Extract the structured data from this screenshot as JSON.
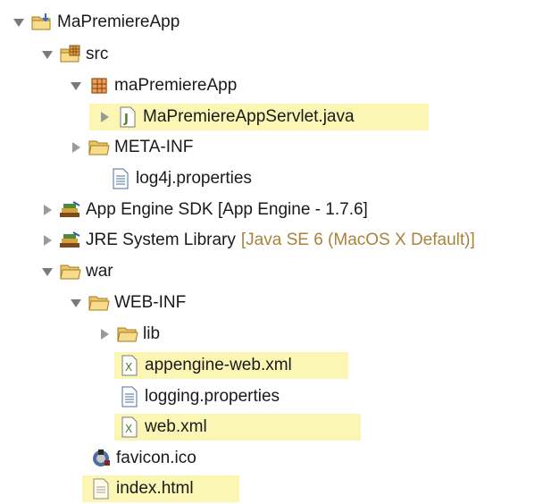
{
  "tree": {
    "project": {
      "label": "MaPremiereApp",
      "icon": "project-folder-icon"
    },
    "src": {
      "label": "src",
      "icon": "source-folder-icon"
    },
    "package": {
      "label": "maPremiereApp",
      "icon": "package-icon"
    },
    "servlet": {
      "label": "MaPremiereAppServlet.java",
      "icon": "java-file-icon",
      "highlighted": true
    },
    "meta_inf": {
      "label": "META-INF",
      "icon": "folder-icon"
    },
    "log4j": {
      "label": "log4j.properties",
      "icon": "text-file-icon"
    },
    "appengine_sdk": {
      "label": "App Engine SDK [App Engine - 1.7.6]",
      "icon": "library-icon"
    },
    "jre": {
      "label": "JRE System Library",
      "decoration": "[Java SE 6 (MacOS X Default)]",
      "icon": "library-icon"
    },
    "war": {
      "label": "war",
      "icon": "folder-icon"
    },
    "web_inf": {
      "label": "WEB-INF",
      "icon": "folder-icon"
    },
    "lib": {
      "label": "lib",
      "icon": "folder-icon"
    },
    "appengine_web_xml": {
      "label": "appengine-web.xml",
      "icon": "xml-file-icon",
      "highlighted": true
    },
    "logging_properties": {
      "label": "logging.properties",
      "icon": "text-file-icon"
    },
    "web_xml": {
      "label": "web.xml",
      "icon": "xml-file-icon",
      "highlighted": true
    },
    "favicon": {
      "label": "favicon.ico",
      "icon": "image-file-icon"
    },
    "index_html": {
      "label": "index.html",
      "icon": "html-file-icon",
      "highlighted": true
    }
  },
  "colors": {
    "highlight": "#fbf6b4",
    "decoration_text": "#a8833a",
    "folder": "#e9c46a",
    "twisty": "#7a7a7a"
  }
}
